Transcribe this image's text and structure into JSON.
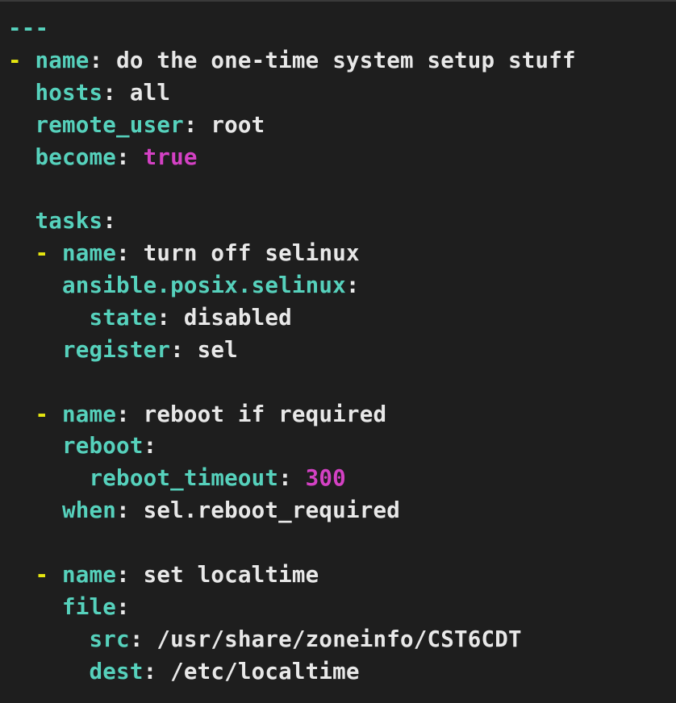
{
  "yaml": {
    "doc_start": "---",
    "play": {
      "dash": "-",
      "name_key": "name",
      "name_val": "do the one-time system setup stuff",
      "hosts_key": "hosts",
      "hosts_val": "all",
      "remote_user_key": "remote_user",
      "remote_user_val": "root",
      "become_key": "become",
      "become_val": "true",
      "tasks_key": "tasks"
    },
    "tasks": [
      {
        "dash": "-",
        "name_key": "name",
        "name_val": "turn off selinux",
        "module_key": "ansible.posix.selinux",
        "args": [
          {
            "key": "state",
            "val": "disabled"
          }
        ],
        "register_key": "register",
        "register_val": "sel"
      },
      {
        "dash": "-",
        "name_key": "name",
        "name_val": "reboot if required",
        "module_key": "reboot",
        "args": [
          {
            "key": "reboot_timeout",
            "val": "300",
            "numeric": true
          }
        ],
        "when_key": "when",
        "when_val": "sel.reboot_required"
      },
      {
        "dash": "-",
        "name_key": "name",
        "name_val": "set localtime",
        "module_key": "file",
        "args": [
          {
            "key": "src",
            "val": "/usr/share/zoneinfo/CST6CDT"
          },
          {
            "key": "dest",
            "val": "/etc/localtime"
          }
        ]
      }
    ],
    "colon": ":"
  }
}
